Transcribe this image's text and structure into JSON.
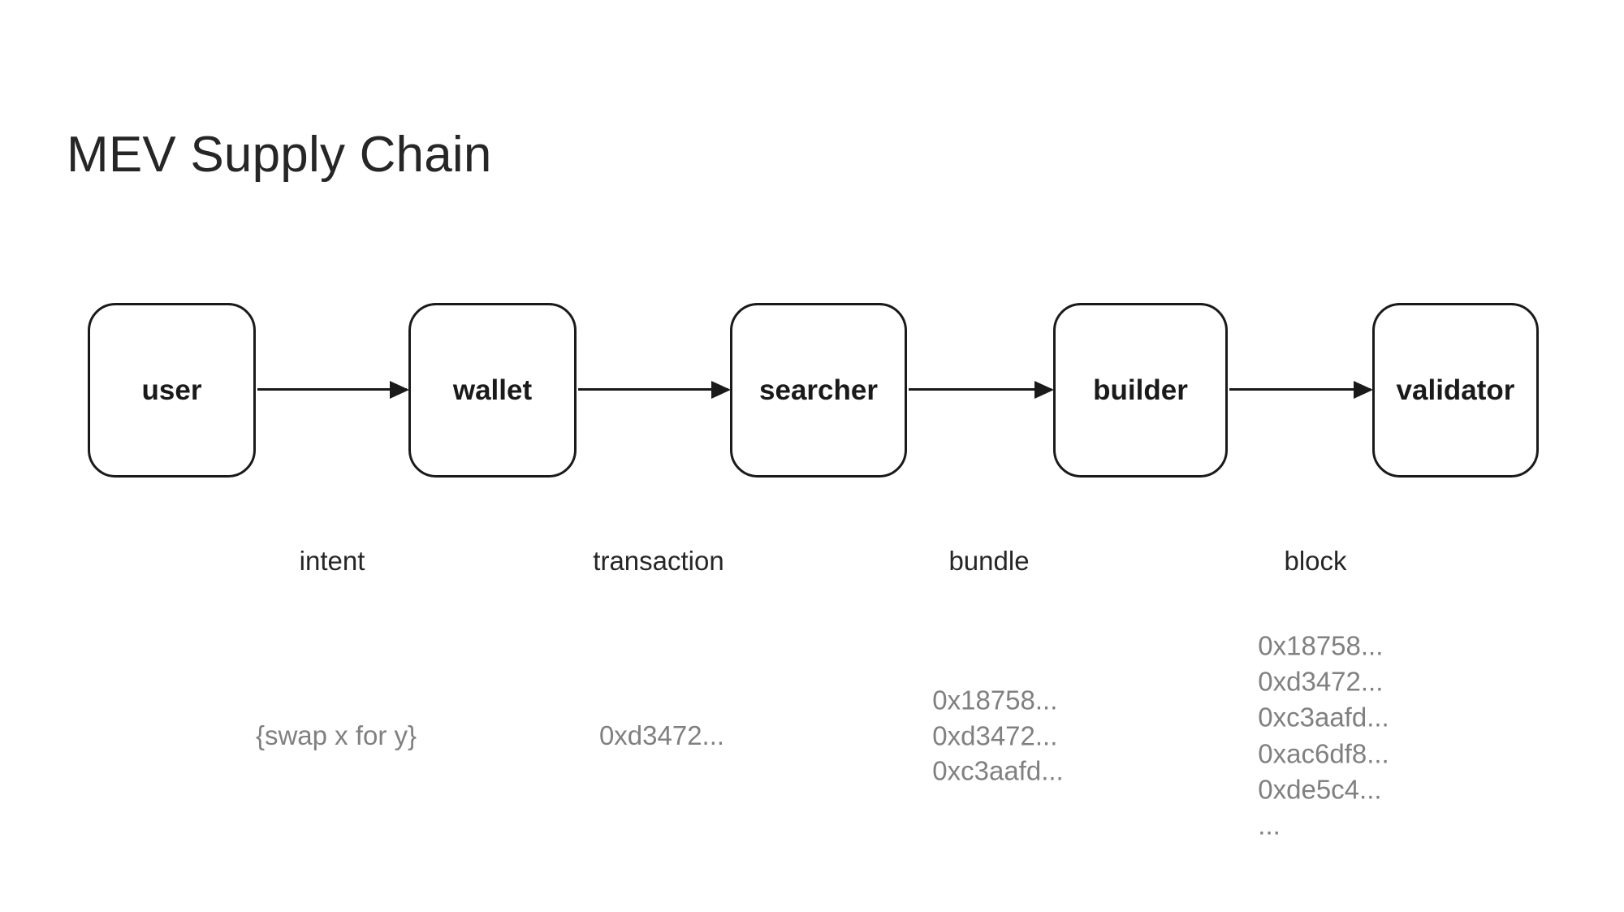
{
  "title": "MEV Supply Chain",
  "colors": {
    "node_stroke": "#1a1a1a",
    "node_fill": "#ffffff",
    "text": "#262626",
    "payload_text": "#808080",
    "background": "#ffffff"
  },
  "diagram": {
    "type": "flow",
    "orientation": "left-to-right",
    "nodes": [
      {
        "id": "user",
        "label": "user"
      },
      {
        "id": "wallet",
        "label": "wallet"
      },
      {
        "id": "searcher",
        "label": "searcher"
      },
      {
        "id": "builder",
        "label": "builder"
      },
      {
        "id": "validator",
        "label": "validator"
      }
    ],
    "edges": [
      {
        "from": "user",
        "to": "wallet",
        "label": "intent"
      },
      {
        "from": "wallet",
        "to": "searcher",
        "label": "transaction"
      },
      {
        "from": "searcher",
        "to": "builder",
        "label": "bundle"
      },
      {
        "from": "builder",
        "to": "validator",
        "label": "block"
      }
    ],
    "payloads": [
      {
        "for_edge": "intent",
        "lines": [
          "{swap x for y}"
        ]
      },
      {
        "for_edge": "transaction",
        "lines": [
          "0xd3472..."
        ]
      },
      {
        "for_edge": "bundle",
        "lines": [
          "0x18758...",
          "0xd3472...",
          "0xc3aafd..."
        ]
      },
      {
        "for_edge": "block",
        "lines": [
          "0x18758...",
          "0xd3472...",
          "0xc3aafd...",
          "0xac6df8...",
          "0xde5c4...",
          "..."
        ]
      }
    ]
  }
}
